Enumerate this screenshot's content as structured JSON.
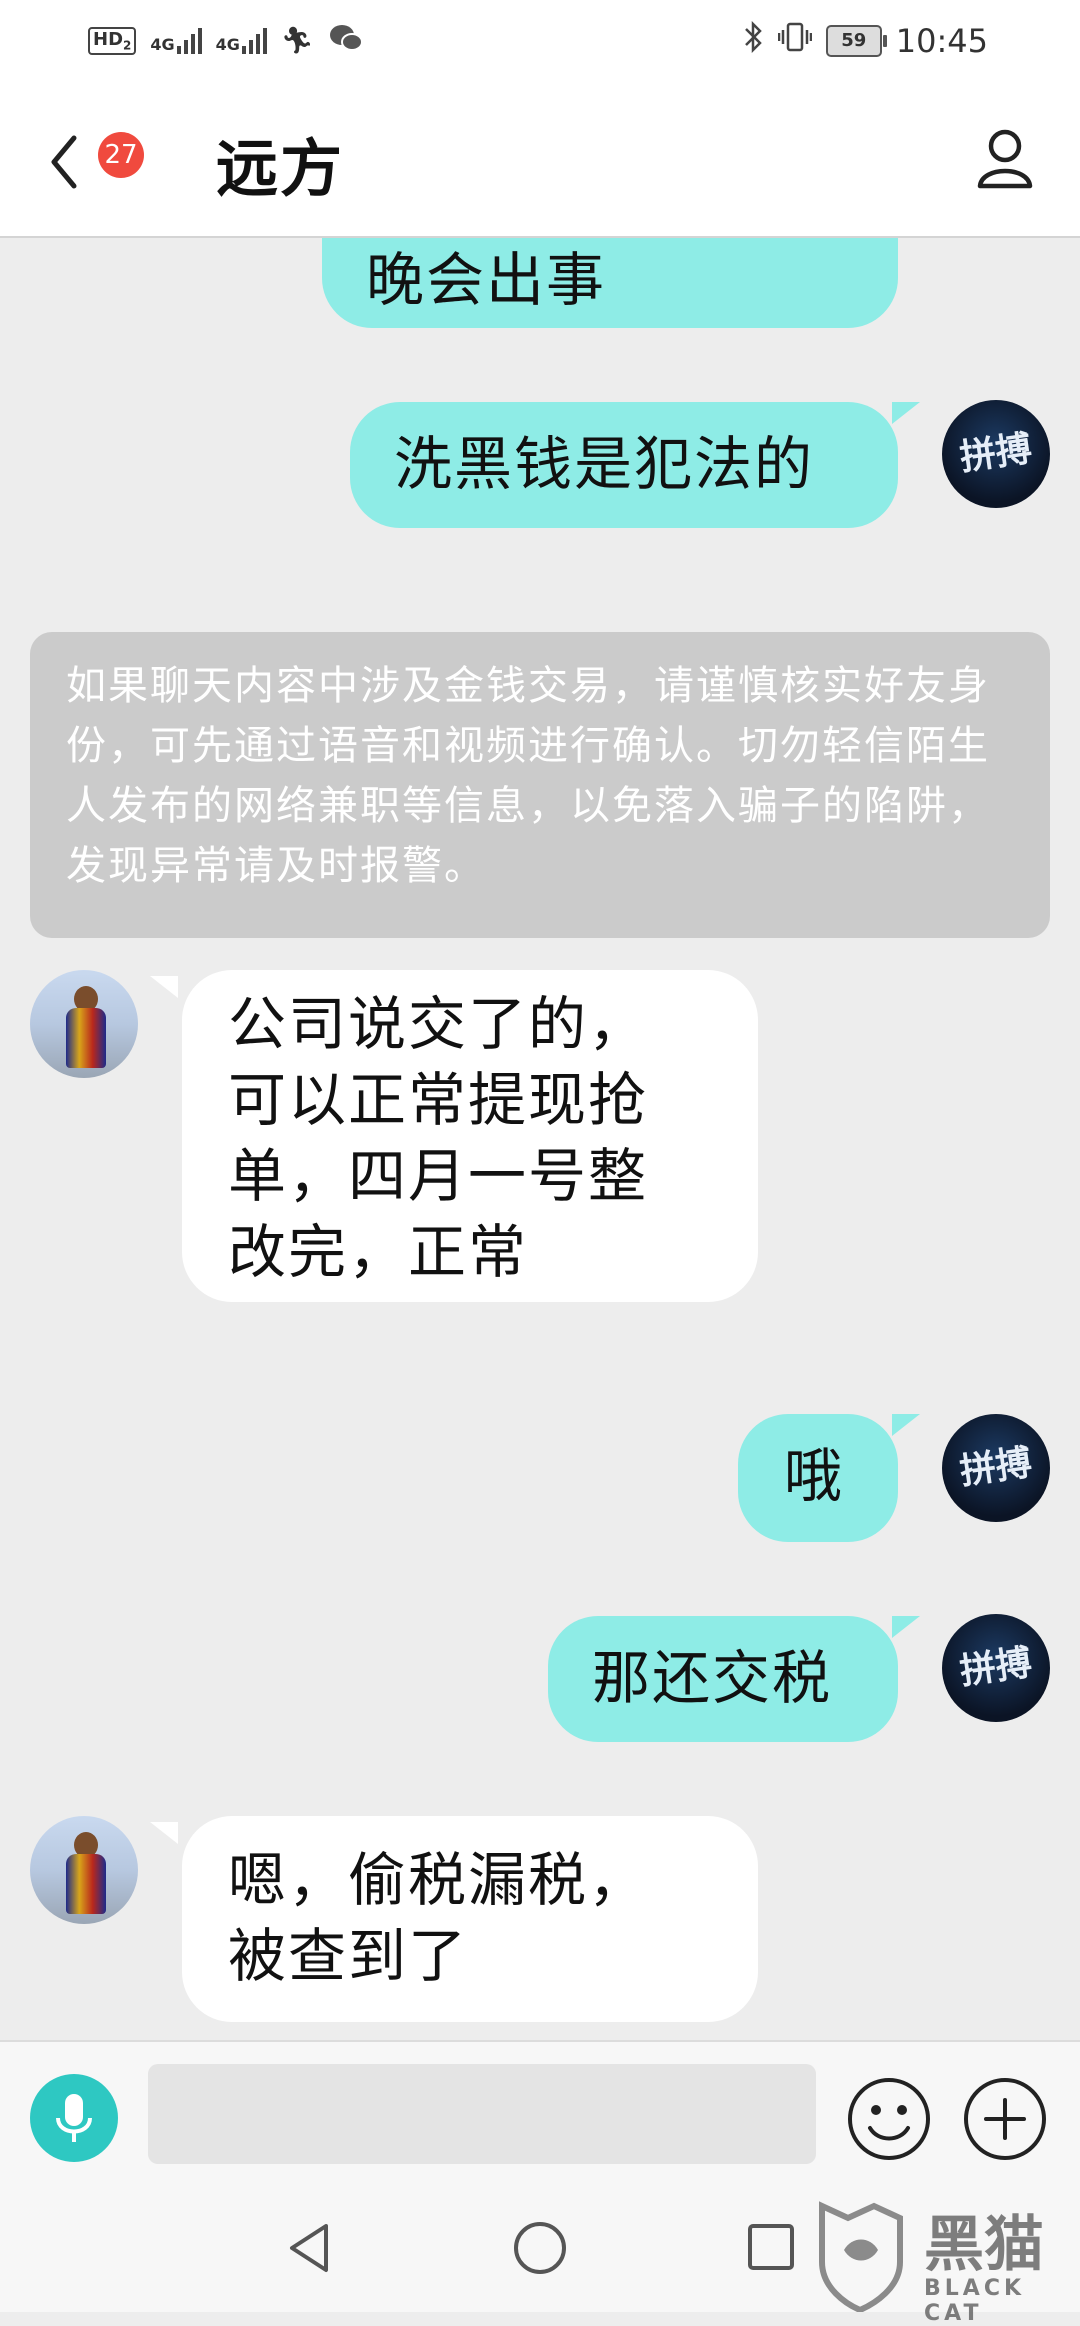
{
  "status_bar": {
    "hd": "HD",
    "hd_sub": "2",
    "network1": "4G",
    "network2": "4G",
    "battery": "59",
    "time": "10:45",
    "icons": [
      "running-icon",
      "wechat-icon",
      "bluetooth-icon",
      "vibrate-icon"
    ]
  },
  "header": {
    "unread_count": "27",
    "title": "远方"
  },
  "messages": [
    {
      "side": "out",
      "text": "晚会出事"
    },
    {
      "side": "out",
      "text": "洗黑钱是犯法的"
    },
    {
      "side": "system",
      "text": "如果聊天内容中涉及金钱交易，请谨慎核实好友身份，可先通过语音和视频进行确认。切勿轻信陌生人发布的网络兼职等信息，以免落入骗子的陷阱，发现异常请及时报警。"
    },
    {
      "side": "in",
      "lines": [
        "公司说交了的，",
        "可以正常提现抢",
        "单，四月一号整",
        "改完，正常"
      ]
    },
    {
      "side": "out",
      "text": "哦"
    },
    {
      "side": "out",
      "text": "那还交税"
    },
    {
      "side": "in",
      "lines": [
        "嗯，偷税漏税，",
        "被查到了"
      ]
    }
  ],
  "avatar_me_text": "拼搏",
  "input": {
    "value": "",
    "placeholder": ""
  },
  "watermark": {
    "brand": "黑猫",
    "sub": "BLACK CAT"
  },
  "colors": {
    "outgoing_bubble": "#8eece6",
    "incoming_bubble": "#ffffff",
    "badge": "#f04a3e",
    "mic": "#2ec8c2",
    "notice_bg": "#cbcbcb"
  }
}
